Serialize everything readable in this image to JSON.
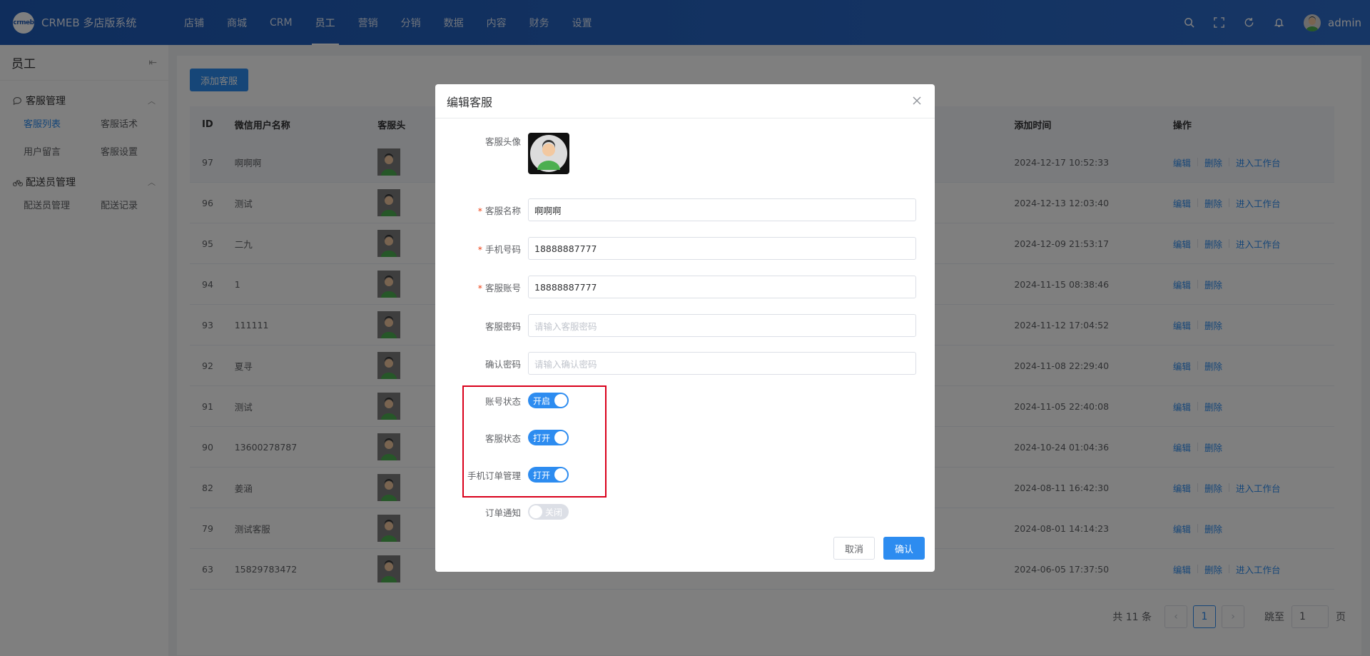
{
  "app": {
    "logo_text": "crmeb",
    "title": "CRMEB 多店版系统"
  },
  "topnav": [
    "店铺",
    "商城",
    "CRM",
    "员工",
    "营销",
    "分销",
    "数据",
    "内容",
    "财务",
    "设置"
  ],
  "user": {
    "name": "admin"
  },
  "sidebar": {
    "title": "员工",
    "groups": [
      {
        "label": "客服管理",
        "items": [
          "客服列表",
          "客服话术",
          "用户留言",
          "客服设置"
        ]
      },
      {
        "label": "配送员管理",
        "items": [
          "配送员管理",
          "配送记录"
        ]
      }
    ]
  },
  "toolbar": {
    "add_label": "添加客服"
  },
  "table": {
    "headers": {
      "id": "ID",
      "name": "微信用户名称",
      "avatar": "客服头",
      "time": "添加时间",
      "ops": "操作"
    },
    "rows": [
      {
        "id": "97",
        "name": "啊啊啊",
        "time": "2024-12-17 10:52:33",
        "enter": true
      },
      {
        "id": "96",
        "name": "测试",
        "time": "2024-12-13 12:03:40",
        "enter": true
      },
      {
        "id": "95",
        "name": "二九",
        "time": "2024-12-09 21:53:17",
        "enter": true
      },
      {
        "id": "94",
        "name": "1",
        "time": "2024-11-15 08:38:46",
        "enter": false
      },
      {
        "id": "93",
        "name": "111111",
        "time": "2024-11-12 17:04:52",
        "enter": false
      },
      {
        "id": "92",
        "name": "夏寻",
        "time": "2024-11-08 22:29:40",
        "enter": false
      },
      {
        "id": "91",
        "name": "测试",
        "time": "2024-11-05 22:40:08",
        "enter": false
      },
      {
        "id": "90",
        "name": "13600278787",
        "time": "2024-10-24 01:04:36",
        "enter": false
      },
      {
        "id": "82",
        "name": "姜涵",
        "time": "2024-08-11 16:42:30",
        "enter": true
      },
      {
        "id": "79",
        "name": "测试客服",
        "time": "2024-08-01 14:14:23",
        "enter": false
      },
      {
        "id": "63",
        "name": "15829783472",
        "time": "2024-06-05 17:37:50",
        "enter": true
      }
    ],
    "ops": {
      "edit": "编辑",
      "delete": "删除",
      "enter": "进入工作台"
    }
  },
  "pager": {
    "total": "共 11 条",
    "current": "1",
    "jump": "跳至",
    "jump_value": "1",
    "page_unit": "页",
    "prev": "‹",
    "next": "›"
  },
  "modal": {
    "title": "编辑客服",
    "avatar_label": "客服头像",
    "name_label": "客服名称",
    "name_value": "啊啊啊",
    "phone_label": "手机号码",
    "phone_value": "18888887777",
    "account_label": "客服账号",
    "account_value": "18888887777",
    "password_label": "客服密码",
    "password_placeholder": "请输入客服密码",
    "confirm_label": "确认密码",
    "confirm_placeholder": "请输入确认密码",
    "account_status_label": "账号状态",
    "account_status_value": "开启",
    "service_status_label": "客服状态",
    "service_status_value": "打开",
    "order_manage_label": "手机订单管理",
    "order_manage_value": "打开",
    "order_notice_label": "订单通知",
    "order_notice_value": "关闭",
    "cancel_label": "取消",
    "ok_label": "确认"
  },
  "colors": {
    "primary": "#2d8cf0",
    "topbar": "#1e5bb8",
    "highlight": "#d9001b"
  }
}
